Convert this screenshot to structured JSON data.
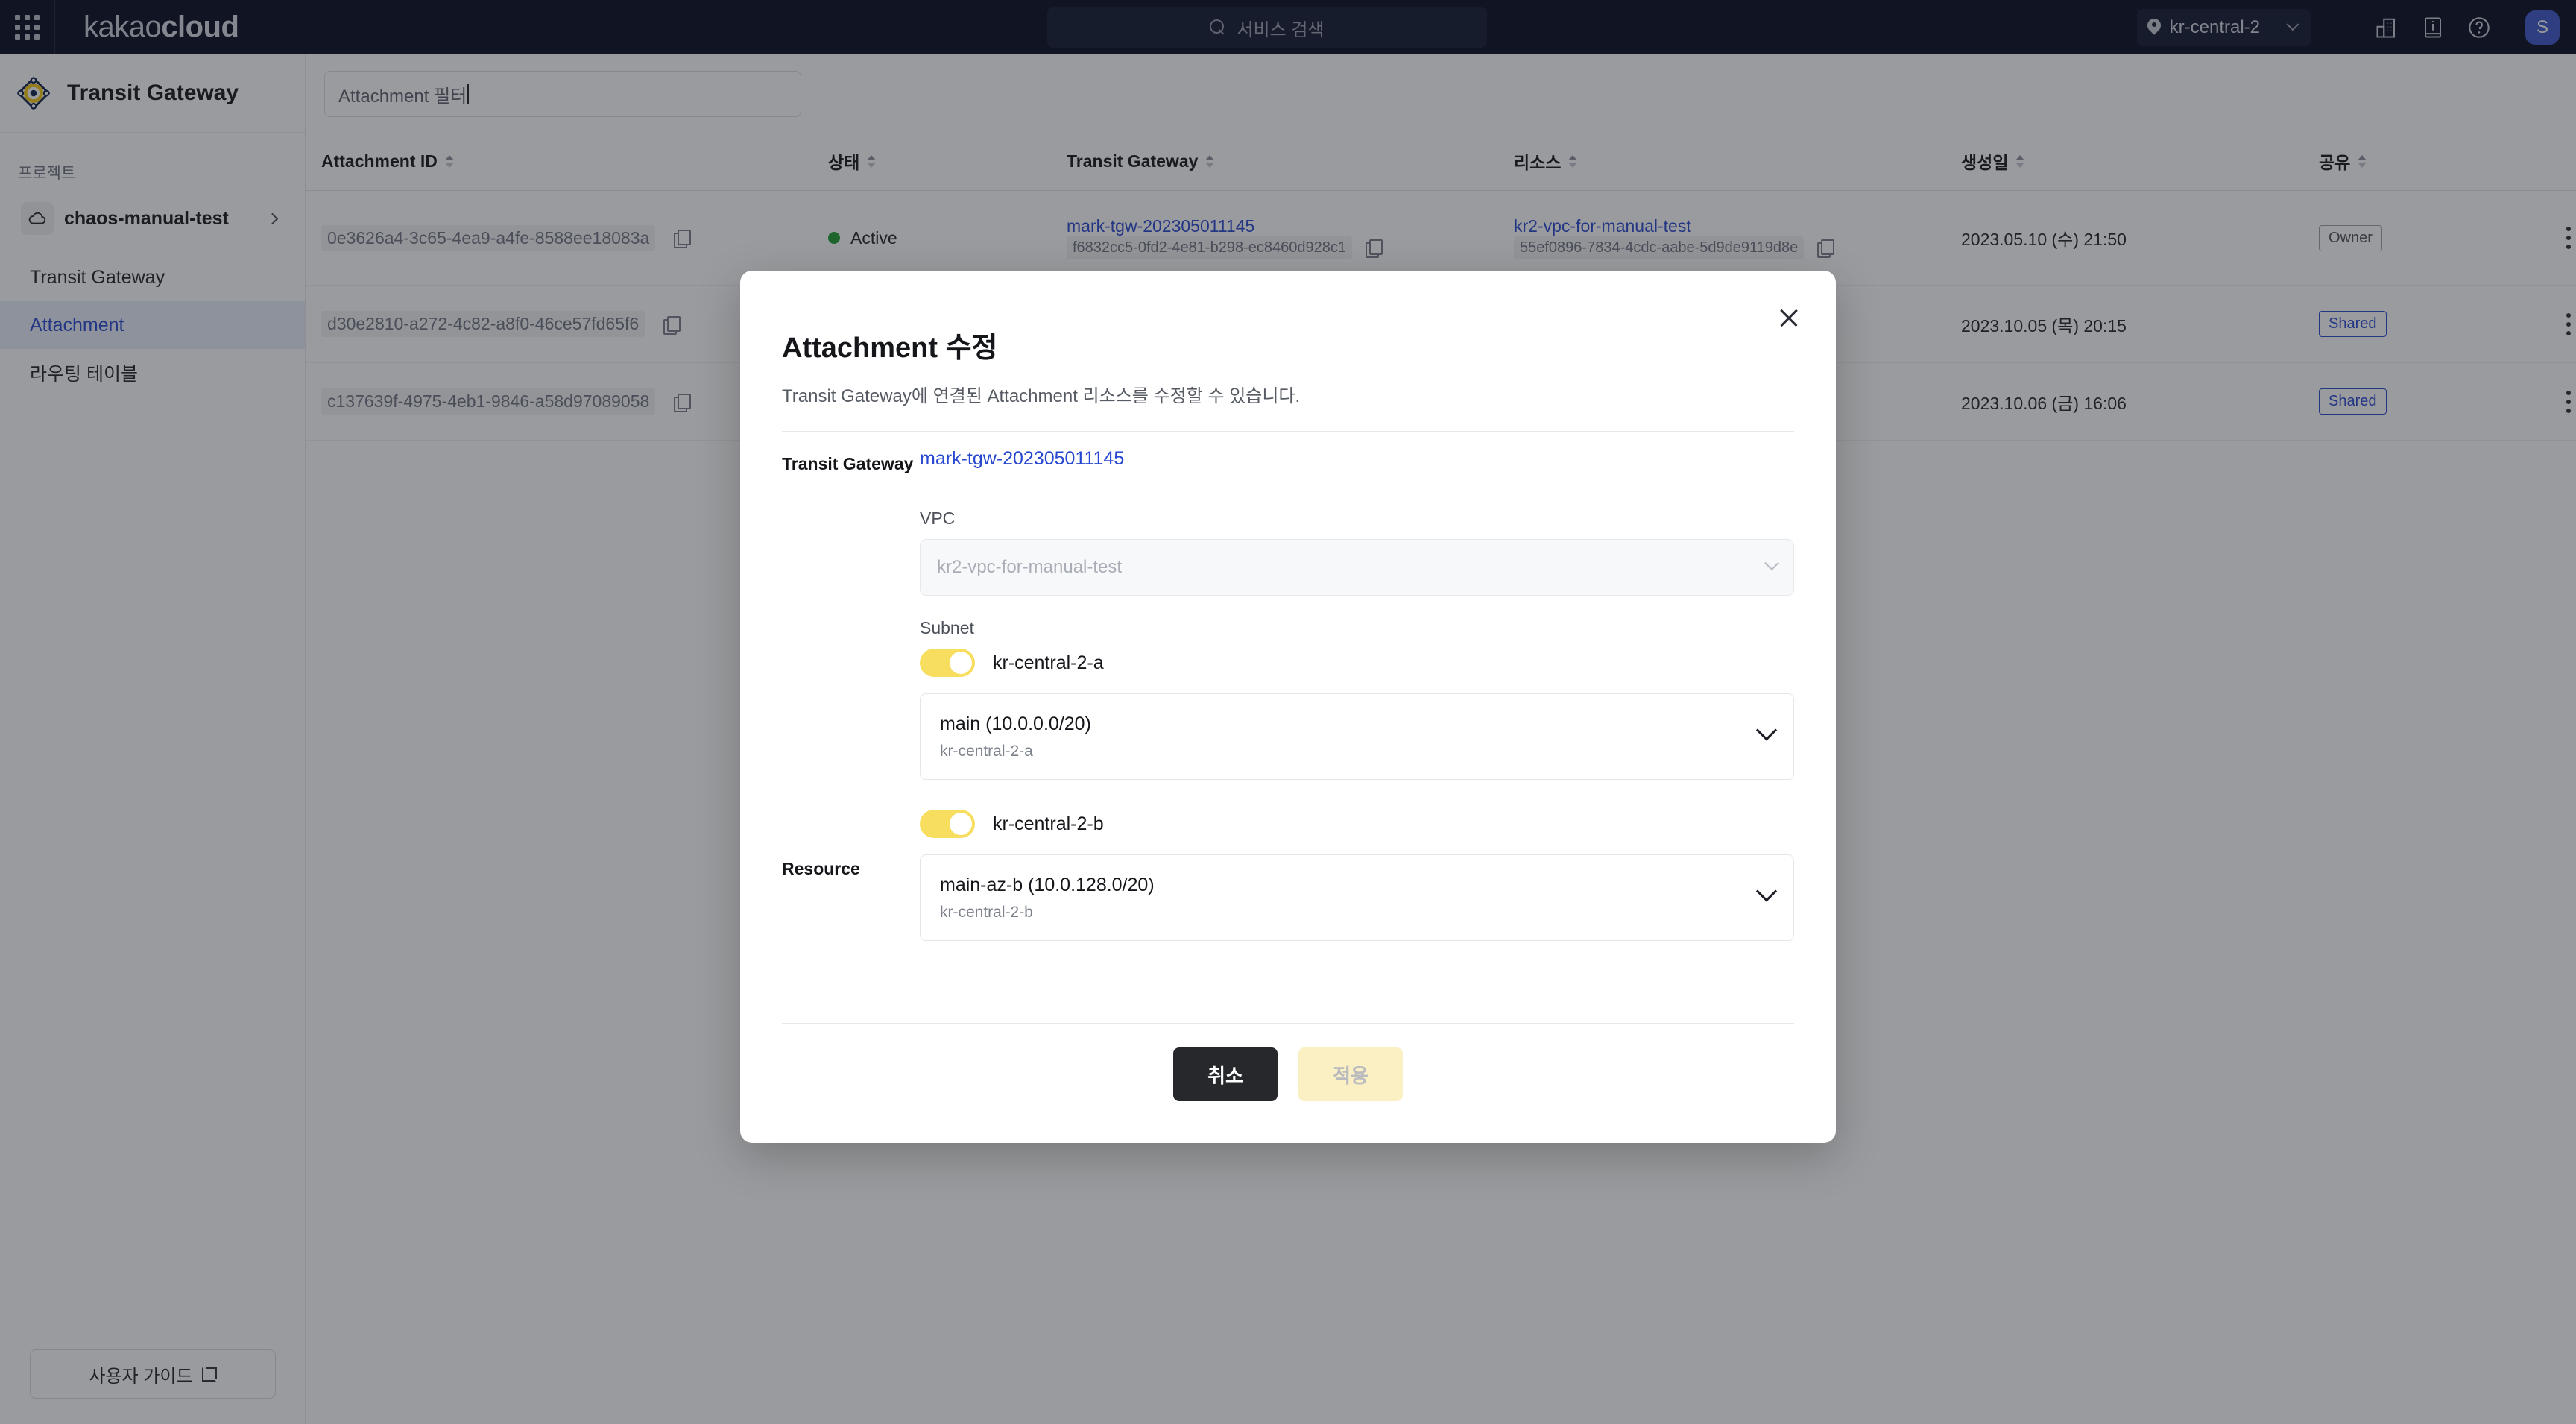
{
  "header": {
    "brand_light": "kakao",
    "brand_bold": "cloud",
    "search_placeholder": "서비스 검색",
    "region": "kr-central-2",
    "avatar_initial": "S",
    "icons": [
      "apps-grid-icon",
      "search-icon",
      "location-pin-icon",
      "chevron-down-icon",
      "organization-icon",
      "docs-icon",
      "help-icon",
      "user-avatar"
    ]
  },
  "sidebar": {
    "service_title": "Transit Gateway",
    "section_label": "프로젝트",
    "project_name": "chaos-manual-test",
    "nav": [
      {
        "label": "Transit Gateway",
        "active": false
      },
      {
        "label": "Attachment",
        "active": true
      },
      {
        "label": "라우팅 테이블",
        "active": false
      }
    ],
    "guide_label": "사용자 가이드"
  },
  "main": {
    "filter_value": "Attachment 필터",
    "table": {
      "columns": [
        "Attachment ID",
        "상태",
        "Transit Gateway",
        "리소스",
        "생성일",
        "공유"
      ],
      "rows": [
        {
          "attachment_id": "0e3626a4-3c65-4ea9-a4fe-8588ee18083a",
          "state": "Active",
          "tgw_name": "mark-tgw-202305011145",
          "tgw_id": "f6832cc5-0fd2-4e81-b298-ec8460d928c1",
          "resource_name": "kr2-vpc-for-manual-test",
          "resource_id": "55ef0896-7834-4cdc-aabe-5d9de9119d8e",
          "created": "2023.05.10 (수) 21:50",
          "share": "Owner"
        },
        {
          "attachment_id": "d30e2810-a272-4c82-a8f0-46ce57fd65f6",
          "state": "",
          "tgw_name": "",
          "tgw_id": "",
          "resource_name": "",
          "resource_id": "",
          "created": "2023.10.05 (목) 20:15",
          "share": "Shared"
        },
        {
          "attachment_id": "c137639f-4975-4eb1-9846-a58d97089058",
          "state": "",
          "tgw_name": "",
          "tgw_id": "",
          "resource_name": "",
          "resource_id": "",
          "created": "2023.10.06 (금) 16:06",
          "share": "Shared"
        }
      ]
    }
  },
  "modal": {
    "title": "Attachment 수정",
    "description": "Transit Gateway에 연결된 Attachment 리소스를 수정할 수 있습니다.",
    "fields": {
      "tgw_label": "Transit Gateway",
      "tgw_value": "mark-tgw-202305011145",
      "vpc_label": "VPC",
      "vpc_value": "kr2-vpc-for-manual-test",
      "subnet_label": "Subnet",
      "resource_label": "Resource"
    },
    "subnets": [
      {
        "az": "kr-central-2-a",
        "enabled": true,
        "selection_title": "main (10.0.0.0/20)",
        "selection_sub": "kr-central-2-a"
      },
      {
        "az": "kr-central-2-b",
        "enabled": true,
        "selection_title": "main-az-b (10.0.128.0/20)",
        "selection_sub": "kr-central-2-b"
      }
    ],
    "buttons": {
      "cancel": "취소",
      "apply": "적용"
    }
  },
  "colors": {
    "header_bg": "#040A1F",
    "accent_yellow": "#F8DE5F",
    "link_blue": "#2747D0",
    "active_nav_bg": "#E8EEFC",
    "status_green": "#1E9E2F",
    "avatar_blue": "#3B56C8"
  }
}
